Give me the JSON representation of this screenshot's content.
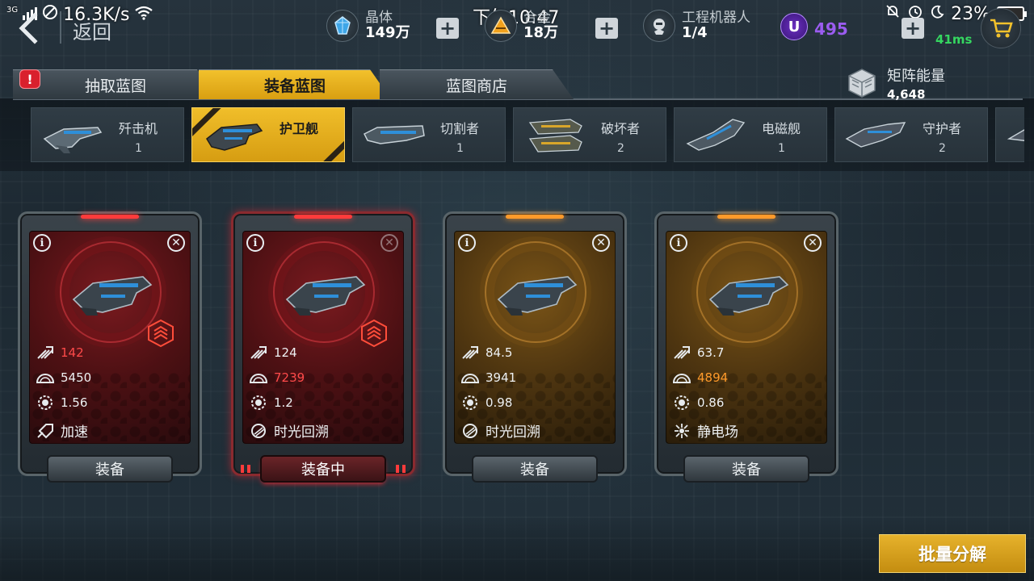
{
  "status_bar": {
    "network": "3G",
    "speed": "16.3K/s",
    "time": "下午10:47",
    "battery": "23%"
  },
  "header": {
    "back_label": "返回",
    "resources": [
      {
        "icon": "crystal-icon",
        "label": "晶体",
        "value": "149万"
      },
      {
        "icon": "metal-icon",
        "label": "合金",
        "value": "18万"
      },
      {
        "icon": "robot-icon",
        "label": "工程机器人",
        "value": "1/4"
      }
    ],
    "u_currency": "495",
    "ping": "41ms",
    "plus_symbol": "+"
  },
  "tabs": [
    {
      "label": "抽取蓝图",
      "active": false,
      "badge": "!"
    },
    {
      "label": "装备蓝图",
      "active": true
    },
    {
      "label": "蓝图商店",
      "active": false
    }
  ],
  "matrix_energy": {
    "label": "矩阵能量",
    "value": "4,648"
  },
  "ship_types": [
    {
      "name": "歼击机",
      "count": "1",
      "active": false
    },
    {
      "name": "护卫舰",
      "count": "",
      "active": true
    },
    {
      "name": "切割者",
      "count": "1",
      "active": false
    },
    {
      "name": "破坏者",
      "count": "2",
      "active": false
    },
    {
      "name": "电磁舰",
      "count": "1",
      "active": false
    },
    {
      "name": "守护者",
      "count": "2",
      "active": false
    }
  ],
  "cards": [
    {
      "theme": "red",
      "attack": "142",
      "attack_color": "#ff4a4a",
      "hp": "5450",
      "hp_color": "#eef1f3",
      "speed": "1.56",
      "skill": "加速",
      "button": "装备",
      "equipped": false,
      "ranked": true,
      "top_glow": "#ff3b3b"
    },
    {
      "theme": "red",
      "attack": "124",
      "attack_color": "#eef1f3",
      "hp": "7239",
      "hp_color": "#ff4a4a",
      "speed": "1.2",
      "skill": "时光回溯",
      "button": "装备中",
      "equipped": true,
      "ranked": true,
      "top_glow": "#ff3b3b"
    },
    {
      "theme": "gold",
      "attack": "84.5",
      "attack_color": "#eef1f3",
      "hp": "3941",
      "hp_color": "#eef1f3",
      "speed": "0.98",
      "skill": "时光回溯",
      "button": "装备",
      "equipped": false,
      "ranked": false,
      "top_glow": "#ff9a2a"
    },
    {
      "theme": "gold",
      "attack": "63.7",
      "attack_color": "#eef1f3",
      "hp": "4894",
      "hp_color": "#ff9a2a",
      "speed": "0.86",
      "skill": "静电场",
      "button": "装备",
      "equipped": false,
      "ranked": false,
      "top_glow": "#ff9a2a"
    }
  ],
  "batch_button": "批量分解",
  "info_glyph": "i",
  "close_glyph": "✕"
}
